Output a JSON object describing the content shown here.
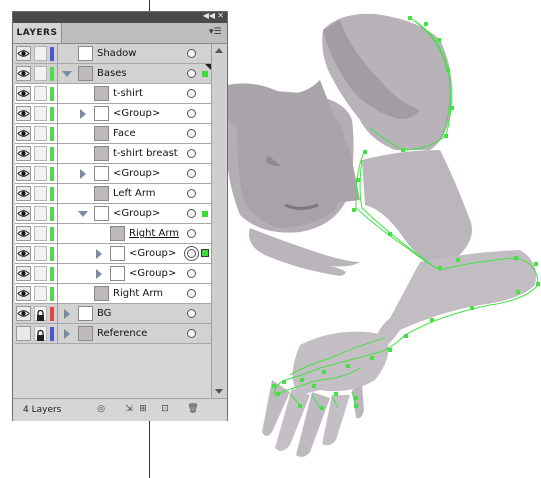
{
  "panel": {
    "tab_label": "LAYERS",
    "collapse_glyph": "◀◀",
    "close_glyph": "✕",
    "menu_glyph": "▾☰",
    "footer": {
      "layer_count": "4 Layers",
      "icons": [
        "make-clipping-mask-icon",
        "create-sublayer-icon",
        "create-new-layer-icon",
        "delete-icon"
      ]
    }
  },
  "colors": {
    "blue_layer": "#4b55d8",
    "green_layer": "#4fdc4f",
    "red_layer": "#e34444",
    "selection_green": "#3ddc3d",
    "path_green": "#44e044",
    "artwork_gray": "#b9b4b9"
  },
  "rows": [
    {
      "name": "Shadow",
      "level": "top",
      "visible": true,
      "locked": false,
      "color": "blue",
      "expander": "none",
      "target": "single",
      "selected": false
    },
    {
      "name": "Bases",
      "level": "top",
      "visible": true,
      "locked": false,
      "color": "green",
      "expander": "down",
      "target": "single",
      "selected": true
    },
    {
      "name": "t-shirt",
      "level": "child",
      "visible": true,
      "locked": false,
      "color": "green",
      "expander": "none",
      "target": "single",
      "selected": false
    },
    {
      "name": "<Group>",
      "level": "child",
      "visible": true,
      "locked": false,
      "color": "green",
      "expander": "right",
      "target": "single",
      "selected": false
    },
    {
      "name": "Face",
      "level": "child",
      "visible": true,
      "locked": false,
      "color": "green",
      "expander": "none",
      "target": "single",
      "selected": false
    },
    {
      "name": "t-shirt breast",
      "level": "child",
      "visible": true,
      "locked": false,
      "color": "green",
      "expander": "none",
      "target": "single",
      "selected": false
    },
    {
      "name": "<Group>",
      "level": "child",
      "visible": true,
      "locked": false,
      "color": "green",
      "expander": "right",
      "target": "single",
      "selected": false
    },
    {
      "name": "Left Arm",
      "level": "child",
      "visible": true,
      "locked": false,
      "color": "green",
      "expander": "none",
      "target": "single",
      "selected": false
    },
    {
      "name": "<Group>",
      "level": "child",
      "visible": true,
      "locked": false,
      "color": "green",
      "expander": "down",
      "target": "single",
      "selected": true
    },
    {
      "name": "Right Arm",
      "level": "grandchild",
      "visible": true,
      "locked": false,
      "color": "green",
      "expander": "none",
      "target": "single",
      "selected": false,
      "underline": true
    },
    {
      "name": "<Group>",
      "level": "grandchild",
      "visible": true,
      "locked": false,
      "color": "green",
      "expander": "right",
      "target": "double",
      "selected": true,
      "big_selection": true
    },
    {
      "name": "<Group>",
      "level": "grandchild",
      "visible": true,
      "locked": false,
      "color": "green",
      "expander": "right",
      "target": "single",
      "selected": false
    },
    {
      "name": "Right Arm",
      "level": "child",
      "visible": true,
      "locked": false,
      "color": "green",
      "expander": "none",
      "target": "single",
      "selected": false
    },
    {
      "name": "BG",
      "level": "top",
      "visible": true,
      "locked": true,
      "color": "red",
      "expander": "right",
      "target": "single",
      "selected": false
    },
    {
      "name": "Reference",
      "level": "top",
      "visible": false,
      "locked": true,
      "color": "blue",
      "expander": "right",
      "target": "single",
      "selected": false
    }
  ]
}
